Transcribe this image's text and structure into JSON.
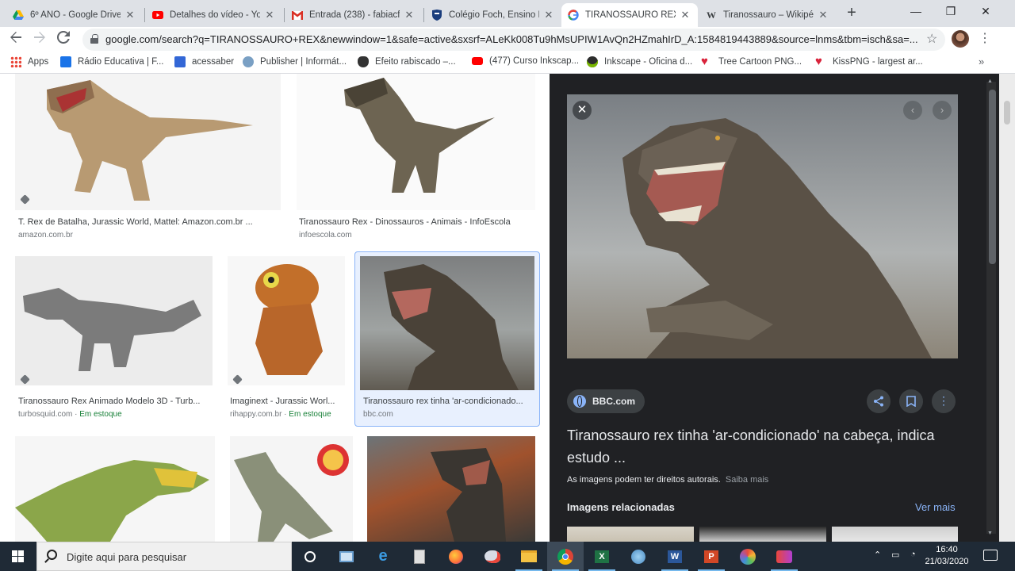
{
  "browser": {
    "tabs": [
      {
        "title": "6º ANO - Google Drive",
        "icon": "google-drive-icon",
        "active": false
      },
      {
        "title": "Detalhes do vídeo - Yo",
        "icon": "youtube-icon",
        "active": false
      },
      {
        "title": "Entrada (238) - fabiacfi",
        "icon": "gmail-icon",
        "active": false
      },
      {
        "title": "Colégio Foch, Ensino F",
        "icon": "school-shield-icon",
        "active": false
      },
      {
        "title": "TIRANOSSAURO REX -",
        "icon": "google-icon",
        "active": true
      },
      {
        "title": "Tiranossauro – Wikipé",
        "icon": "wikipedia-icon",
        "active": false
      }
    ],
    "new_tab": "+",
    "url": "google.com/search?q=TIRANOSSAURO+REX&newwindow=1&safe=active&sxsrf=ALeKk008Tu9hMsUPIW1AvQn2HZmahIrD_A:1584819443889&source=lnms&tbm=isch&sa=...",
    "bookmarks": [
      {
        "label": "Apps",
        "icon": "apps-grid-icon"
      },
      {
        "label": "Rádio Educativa | F...",
        "icon": "radio-flag-icon"
      },
      {
        "label": "acessaber",
        "icon": "acessaber-icon"
      },
      {
        "label": "Publisher | Informát...",
        "icon": "publisher-icon"
      },
      {
        "label": "Efeito rabiscado –...",
        "icon": "cat-icon"
      },
      {
        "label": "(477) Curso Inkscap...",
        "icon": "youtube-icon"
      },
      {
        "label": "Inkscape - Oficina d...",
        "icon": "inkscape-icon"
      },
      {
        "label": "Tree Cartoon PNG...",
        "icon": "heart-icon"
      },
      {
        "label": "KissPNG - largest ar...",
        "icon": "heart-icon"
      }
    ]
  },
  "results": [
    {
      "title": "T. Rex de Batalha, Jurassic World, Mattel: Amazon.com.br ...",
      "source": "amazon.com.br",
      "stock": ""
    },
    {
      "title": "Tiranossauro Rex - Dinossauros - Animais - InfoEscola",
      "source": "infoescola.com",
      "stock": ""
    },
    {
      "title": "Tiranossauro Rex Animado Modelo 3D - Turb...",
      "source": "turbosquid.com",
      "stock": "Em estoque"
    },
    {
      "title": "Imaginext - Jurassic Worl...",
      "source": "rihappy.com.br",
      "stock": "Em estoque"
    },
    {
      "title": "Tiranossauro rex tinha 'ar-condicionado...",
      "source": "bbc.com",
      "stock": ""
    }
  ],
  "preview": {
    "source_chip": "BBC.com",
    "title": "Tiranossauro rex tinha 'ar-condicionado' na cabeça, indica estudo ...",
    "rights_text": "As imagens podem ter direitos autorais.",
    "rights_more": "Saiba mais",
    "related_label": "Imagens relacionadas",
    "see_more": "Ver mais",
    "close": "✕"
  },
  "taskbar": {
    "search_placeholder": "Digite aqui para pesquisar",
    "time": "16:40",
    "date": "21/03/2020"
  },
  "colors": {
    "panel_bg": "#202124",
    "link_blue": "#8ab4f8",
    "stock_green": "#188038",
    "taskbar_bg": "#1f2a36"
  }
}
